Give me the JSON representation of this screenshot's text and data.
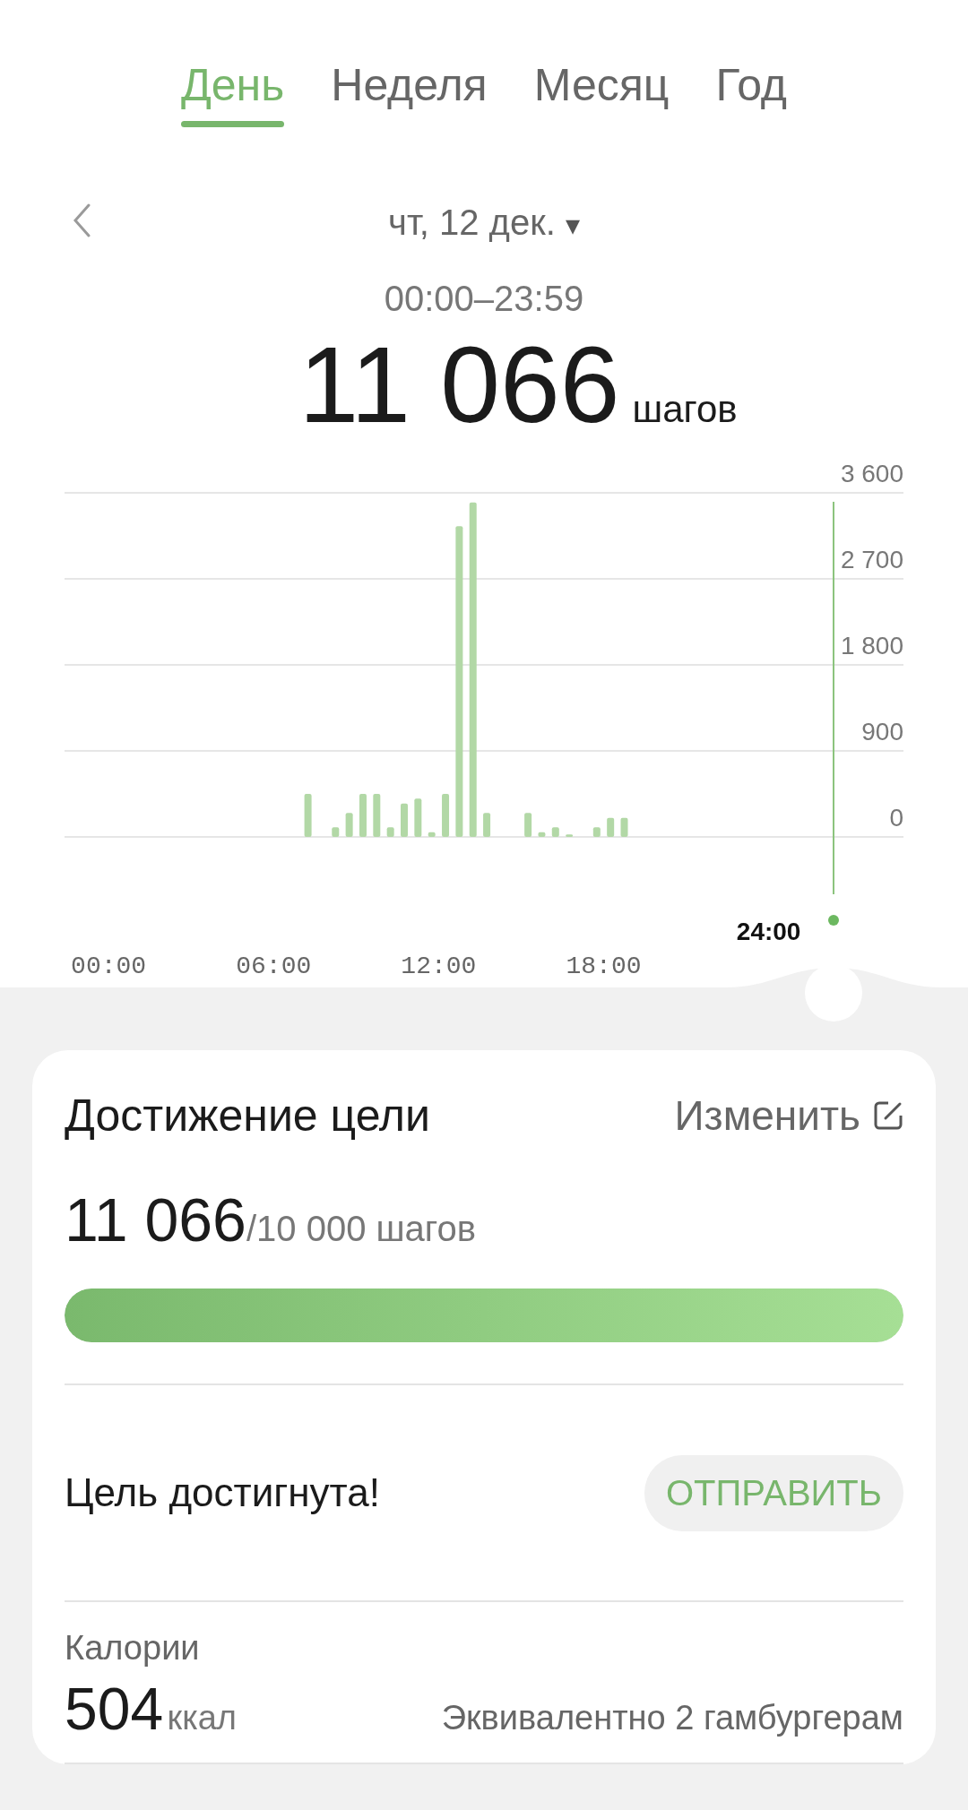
{
  "tabs": [
    {
      "label": "День",
      "selected": true
    },
    {
      "label": "Неделя",
      "selected": false
    },
    {
      "label": "Месяц",
      "selected": false
    },
    {
      "label": "Год",
      "selected": false
    }
  ],
  "date": {
    "label": "чт, 12 дек.",
    "dropdown": "▾"
  },
  "time_range": "00:00–23:59",
  "total": {
    "value": "11 066",
    "unit": "шагов"
  },
  "chart": {
    "cursor_label": "24:00",
    "chart_data": {
      "type": "bar",
      "x": [
        7.25,
        8.25,
        8.75,
        9.25,
        9.75,
        10.25,
        10.75,
        11.25,
        11.75,
        12.25,
        12.75,
        13.25,
        13.75,
        15.25,
        15.75,
        16.25,
        16.75,
        17.75,
        18.25,
        18.75
      ],
      "values": [
        450,
        100,
        250,
        450,
        450,
        100,
        350,
        400,
        50,
        450,
        3250,
        3500,
        250,
        250,
        50,
        100,
        25,
        100,
        200,
        200
      ],
      "xlim": [
        -1.6,
        28.9
      ],
      "ylim": [
        0,
        3600
      ],
      "grid": true,
      "xticks": [
        {
          "value": 0,
          "label": "00:00"
        },
        {
          "value": 6,
          "label": "06:00"
        },
        {
          "value": 12,
          "label": "12:00"
        },
        {
          "value": 18,
          "label": "18:00"
        }
      ],
      "yticks": [
        {
          "value": 0,
          "label": "0"
        },
        {
          "value": 900,
          "label": "900"
        },
        {
          "value": 1800,
          "label": "1 800"
        },
        {
          "value": 2700,
          "label": "2 700"
        },
        {
          "value": 3600,
          "label": "3 600"
        }
      ]
    }
  },
  "goal": {
    "title": "Достижение цели",
    "edit": "Изменить",
    "value": "11 066",
    "target": "/10 000 шагов",
    "level": 1,
    "status": "Цель достигнута!",
    "share": "ОТПРАВИТЬ"
  },
  "calories": {
    "label": "Калории",
    "value": "504",
    "unit": "ккал",
    "equivalent": "Эквивалентно 2 гамбургерам"
  }
}
